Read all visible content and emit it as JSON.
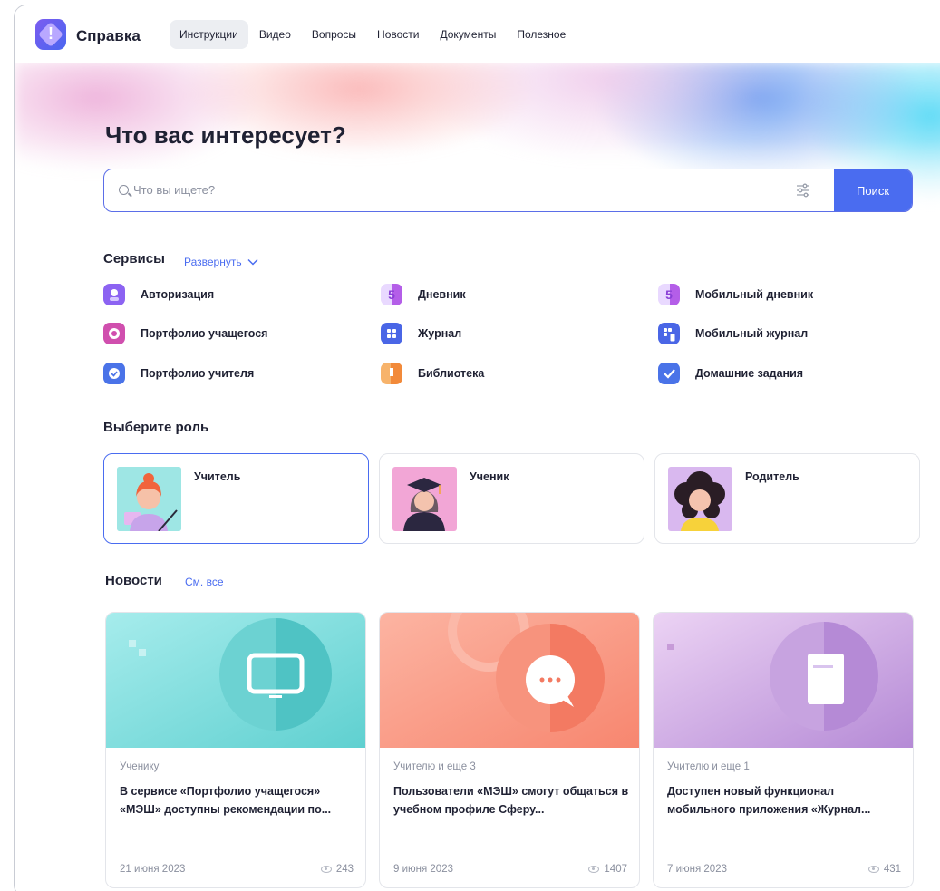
{
  "header": {
    "logo": "info-logo-icon",
    "brand": "Справка",
    "nav": [
      {
        "label": "Инструкции",
        "active": true
      },
      {
        "label": "Видео",
        "active": false
      },
      {
        "label": "Вопросы",
        "active": false
      },
      {
        "label": "Новости",
        "active": false
      },
      {
        "label": "Документы",
        "active": false
      },
      {
        "label": "Полезное",
        "active": false
      }
    ]
  },
  "hero": {
    "title": "Что вас интересует?",
    "search_placeholder": "Что вы ищете?",
    "search_button": "Поиск"
  },
  "services": {
    "title": "Сервисы",
    "expand_link": "Развернуть",
    "items": [
      {
        "label": "Авторизация",
        "icon": "user-icon",
        "color": "#8c63f2"
      },
      {
        "label": "Дневник",
        "icon": "diary-5-icon",
        "color": "#b45ee8"
      },
      {
        "label": "Мобильный дневник",
        "icon": "mobile-diary-icon",
        "color": "#b45ee8"
      },
      {
        "label": "Портфолио учащегося",
        "icon": "portfolio-student-icon",
        "color": "#d04fae"
      },
      {
        "label": "Журнал",
        "icon": "journal-icon",
        "color": "#4a66e6"
      },
      {
        "label": "Мобильный журнал",
        "icon": "mobile-journal-icon",
        "color": "#4a66e6"
      },
      {
        "label": "Портфолио учителя",
        "icon": "portfolio-teacher-icon",
        "color": "#4a73e8"
      },
      {
        "label": "Библиотека",
        "icon": "library-icon",
        "color": "#f29346"
      },
      {
        "label": "Домашние задания",
        "icon": "homework-check-icon",
        "color": "#4a73e8"
      }
    ]
  },
  "roles": {
    "title": "Выберите роль",
    "items": [
      {
        "label": "Учитель",
        "selected": true
      },
      {
        "label": "Ученик",
        "selected": false
      },
      {
        "label": "Родитель",
        "selected": false
      }
    ]
  },
  "news": {
    "title": "Новости",
    "see_all": "См. все",
    "items": [
      {
        "category": "Ученику",
        "title": "В сервисе «Портфолио учащегося» «МЭШ» доступны рекомендации по...",
        "date": "21 июня 2023",
        "views": "243",
        "icon": "monitor-icon"
      },
      {
        "category": "Учителю и еще 3",
        "title": "Пользователи «МЭШ» смогут общаться в учебном профиле Сферу...",
        "date": "9 июня 2023",
        "views": "1407",
        "icon": "chat-bubble-icon"
      },
      {
        "category": "Учителю и еще 1",
        "title": "Доступен новый функционал мобильного приложения «Журнал...",
        "date": "7 июня 2023",
        "views": "431",
        "icon": "book-icon"
      }
    ]
  }
}
